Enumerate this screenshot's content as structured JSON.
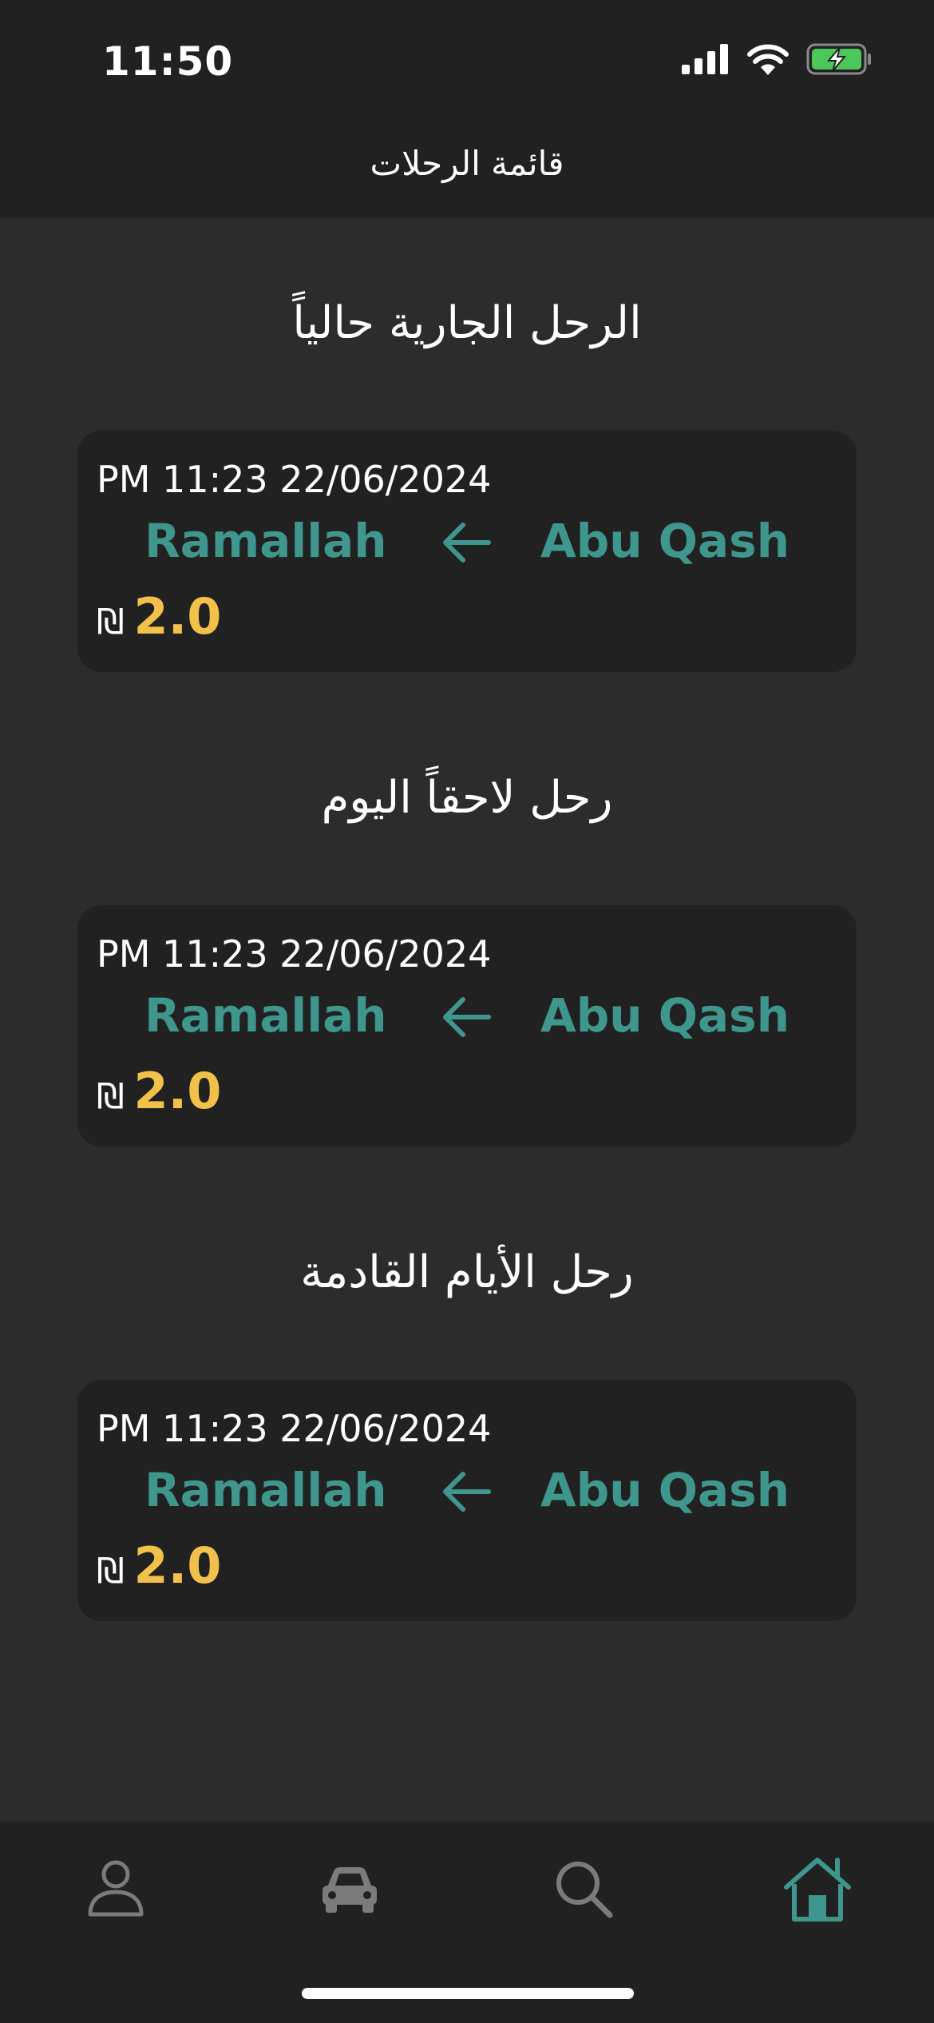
{
  "status_bar": {
    "time": "11:50"
  },
  "header": {
    "title": "قائمة الرحلات"
  },
  "colors": {
    "accent": "#3e968c",
    "price": "#f2c14a",
    "background": "#2c2c2c",
    "surface": "#212121"
  },
  "sections": [
    {
      "title": "الرحل الجارية حالياً",
      "trip": {
        "datetime": "PM 11:23 22/06/2024",
        "to": "Ramallah",
        "from": "Abu Qash",
        "currency": "₪",
        "price": "2.0"
      }
    },
    {
      "title": "رحل لاحقاً اليوم",
      "trip": {
        "datetime": "PM 11:23 22/06/2024",
        "to": "Ramallah",
        "from": "Abu Qash",
        "currency": "₪",
        "price": "2.0"
      }
    },
    {
      "title": "رحل الأيام القادمة",
      "trip": {
        "datetime": "PM 11:23 22/06/2024",
        "to": "Ramallah",
        "from": "Abu Qash",
        "currency": "₪",
        "price": "2.0"
      }
    }
  ],
  "tabbar": {
    "tabs": [
      {
        "icon": "person-icon",
        "active": false
      },
      {
        "icon": "car-icon",
        "active": false
      },
      {
        "icon": "search-icon",
        "active": false
      },
      {
        "icon": "home-icon",
        "active": true
      }
    ]
  }
}
